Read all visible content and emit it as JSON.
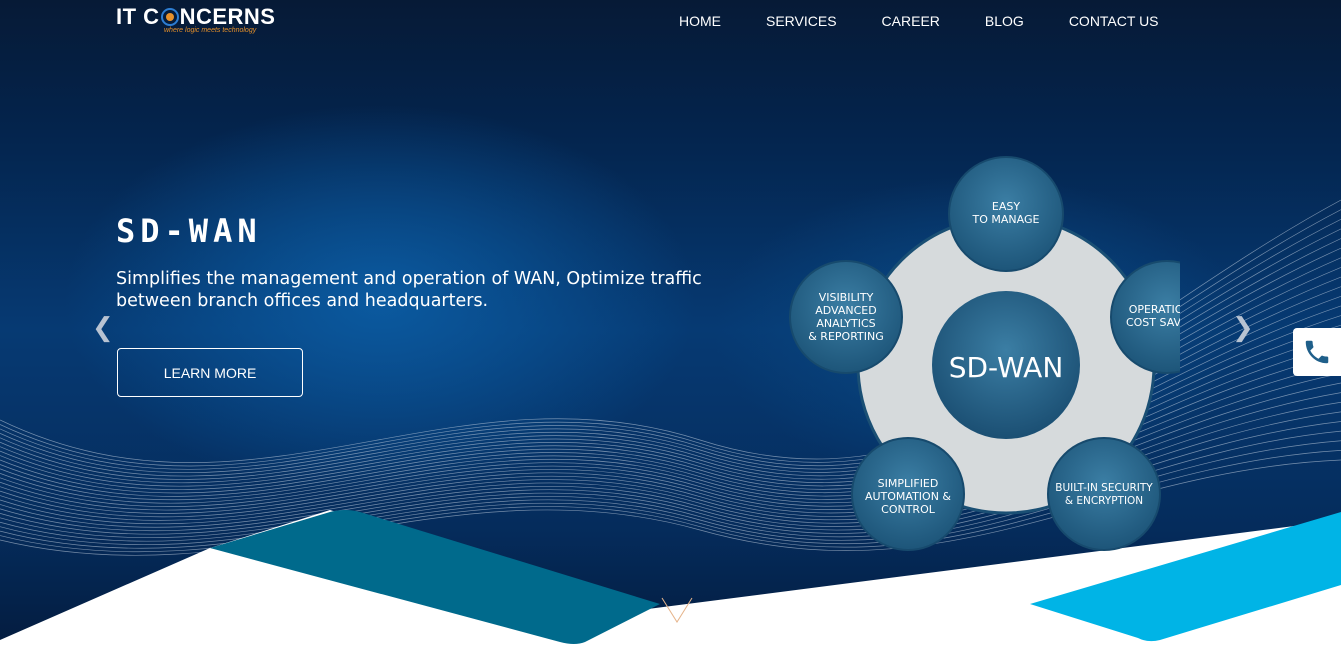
{
  "header": {
    "logo": {
      "text_left": "IT C",
      "text_right": "NCERNS",
      "tagline": "where logic meets technology"
    },
    "nav": [
      "HOME",
      "SERVICES",
      "CAREER",
      "BLOG",
      "CONTACT US"
    ]
  },
  "slide": {
    "title": "SD-WAN",
    "subtitle": "Simplifies the management and operation of WAN, Optimize traffic between branch offices and headquarters.",
    "button": "LEARN MORE"
  },
  "carousel": {
    "prev_icon": "chevron-left-icon",
    "next_icon": "chevron-right-icon"
  },
  "diagram": {
    "center": "SD-WAN",
    "nodes": [
      {
        "lines": [
          "EASY",
          "TO MANAGE"
        ]
      },
      {
        "lines": [
          "OPERATIONAL",
          "COST SAVINGS"
        ]
      },
      {
        "lines": [
          "BUILT-IN SECURITY",
          "& ENCRYPTION"
        ]
      },
      {
        "lines": [
          "SIMPLIFIED",
          "AUTOMATION &",
          "CONTROL"
        ]
      },
      {
        "lines": [
          "VISIBILITY",
          "ADVANCED",
          "ANALYTICS",
          "& REPORTING"
        ]
      }
    ]
  },
  "floating": {
    "phone_icon": "phone-icon"
  },
  "colors": {
    "accent_teal": "#006a8c",
    "accent_cyan": "#00b4e6",
    "logo_orange": "#e8912a",
    "logo_blue": "#2d7dd2"
  }
}
